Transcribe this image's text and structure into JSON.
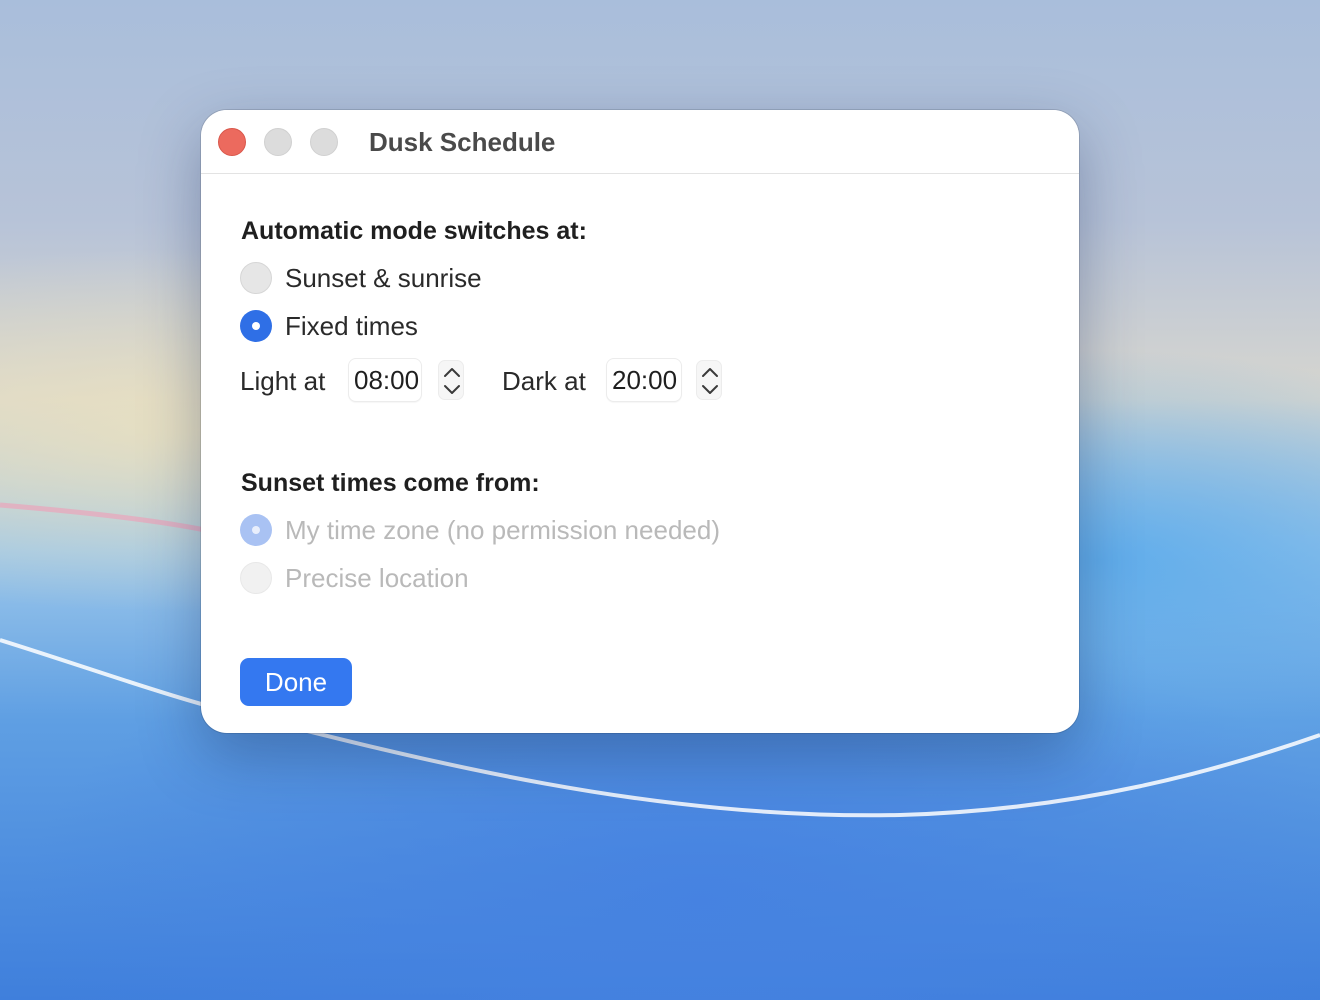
{
  "window": {
    "title": "Dusk Schedule"
  },
  "mode_section": {
    "heading": "Automatic mode switches at:",
    "options": [
      {
        "label": "Sunset & sunrise",
        "selected": false
      },
      {
        "label": "Fixed times",
        "selected": true
      }
    ],
    "light_label": "Light at",
    "light_time": "08:00",
    "dark_label": "Dark at",
    "dark_time": "20:00"
  },
  "source_section": {
    "heading": "Sunset times come from:",
    "options": [
      {
        "label": "My time zone (no permission needed)",
        "selected": true,
        "disabled": true
      },
      {
        "label": "Precise location",
        "selected": false,
        "disabled": true
      }
    ]
  },
  "done_label": "Done",
  "colors": {
    "accent": "#3478f0",
    "close_button": "#ec6a5e"
  }
}
